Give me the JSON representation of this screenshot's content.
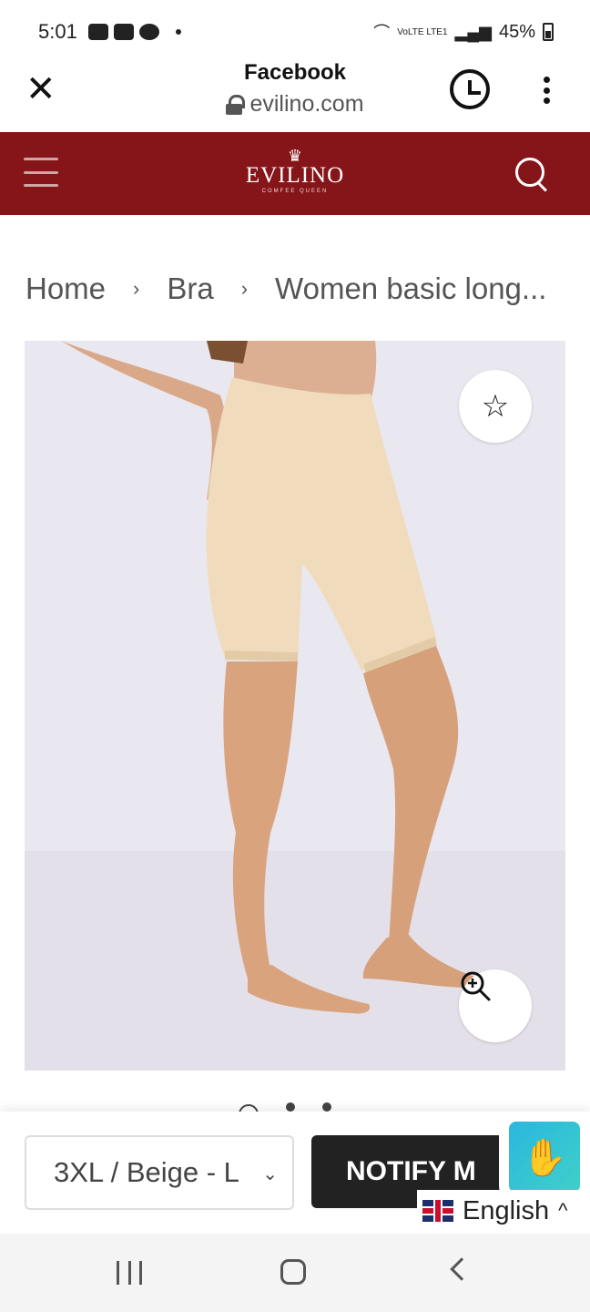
{
  "status_bar": {
    "time": "5:01",
    "battery": "45%",
    "network": "VoLTE LTE1"
  },
  "browser": {
    "title": "Facebook",
    "url": "evilino.com"
  },
  "site": {
    "brand": "EVILINO",
    "tagline": "COMFEE QUEEN",
    "brand_color": "#861519"
  },
  "breadcrumb": {
    "items": [
      "Home",
      "Bra",
      "Women basic long..."
    ],
    "separator": "›"
  },
  "product": {
    "gallery_count": 3,
    "gallery_active_index": 0
  },
  "purchase_bar": {
    "variant": "3XL / Beige - L",
    "notify_button": "NOTIFY M"
  },
  "language": {
    "selected": "English"
  }
}
